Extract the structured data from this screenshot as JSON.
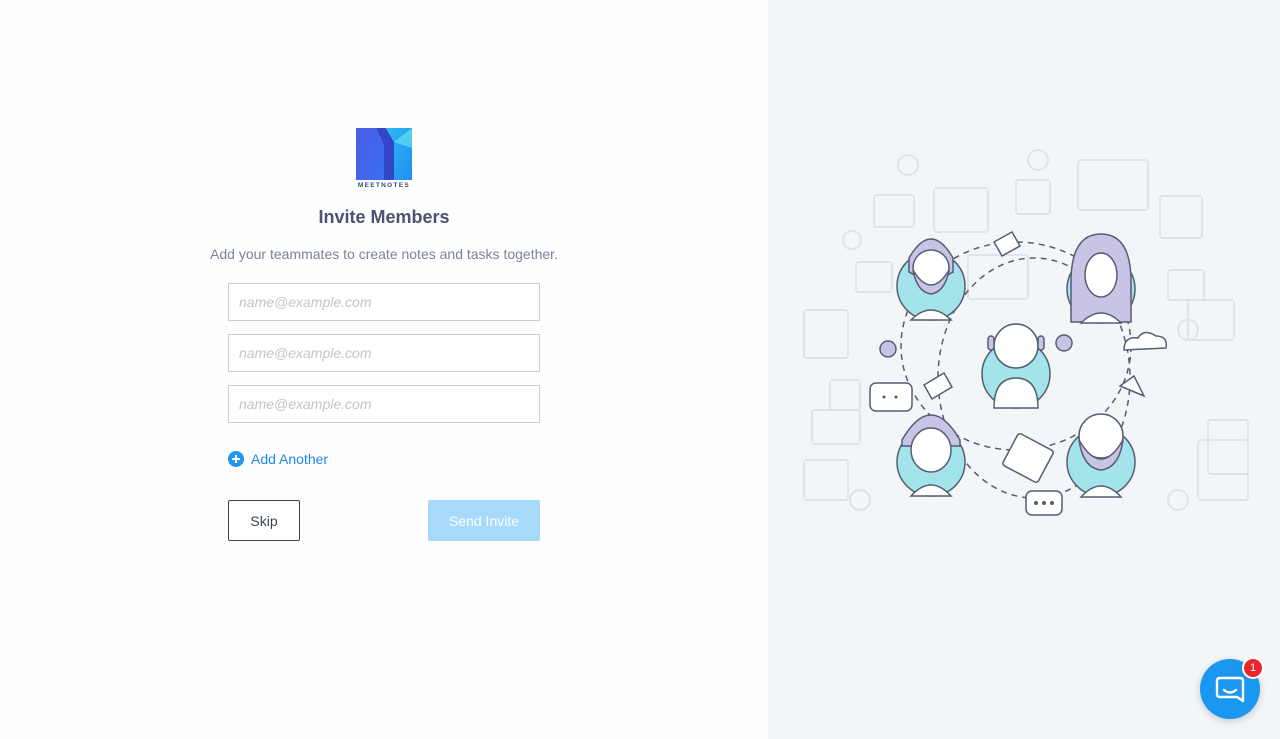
{
  "brand": {
    "name": "MEETNOTES",
    "logo_colors": [
      "#4a5ce6",
      "#2fb8f4",
      "#6ae0f0"
    ]
  },
  "page": {
    "title": "Invite Members",
    "subtitle": "Add your teammates to create notes and tasks together."
  },
  "form": {
    "emails": [
      {
        "placeholder": "name@example.com",
        "value": ""
      },
      {
        "placeholder": "name@example.com",
        "value": ""
      },
      {
        "placeholder": "name@example.com",
        "value": ""
      }
    ],
    "add_another_label": "Add Another",
    "add_another_icon": "plus-circle-icon",
    "skip_label": "Skip",
    "send_label": "Send Invite"
  },
  "chat_widget": {
    "icon": "chat-bubble-icon",
    "badge_count": "1",
    "color": "#1a97ee"
  },
  "illustration": {
    "subject": "team-collaboration",
    "accent_color": "#9fe2ea",
    "figure_color": "#c9c4e6"
  },
  "colors": {
    "accent": "#1e88e5",
    "title": "#4a5370",
    "disabled_button": "#a6d9fa",
    "right_panel_bg": "#f3f6f9"
  }
}
